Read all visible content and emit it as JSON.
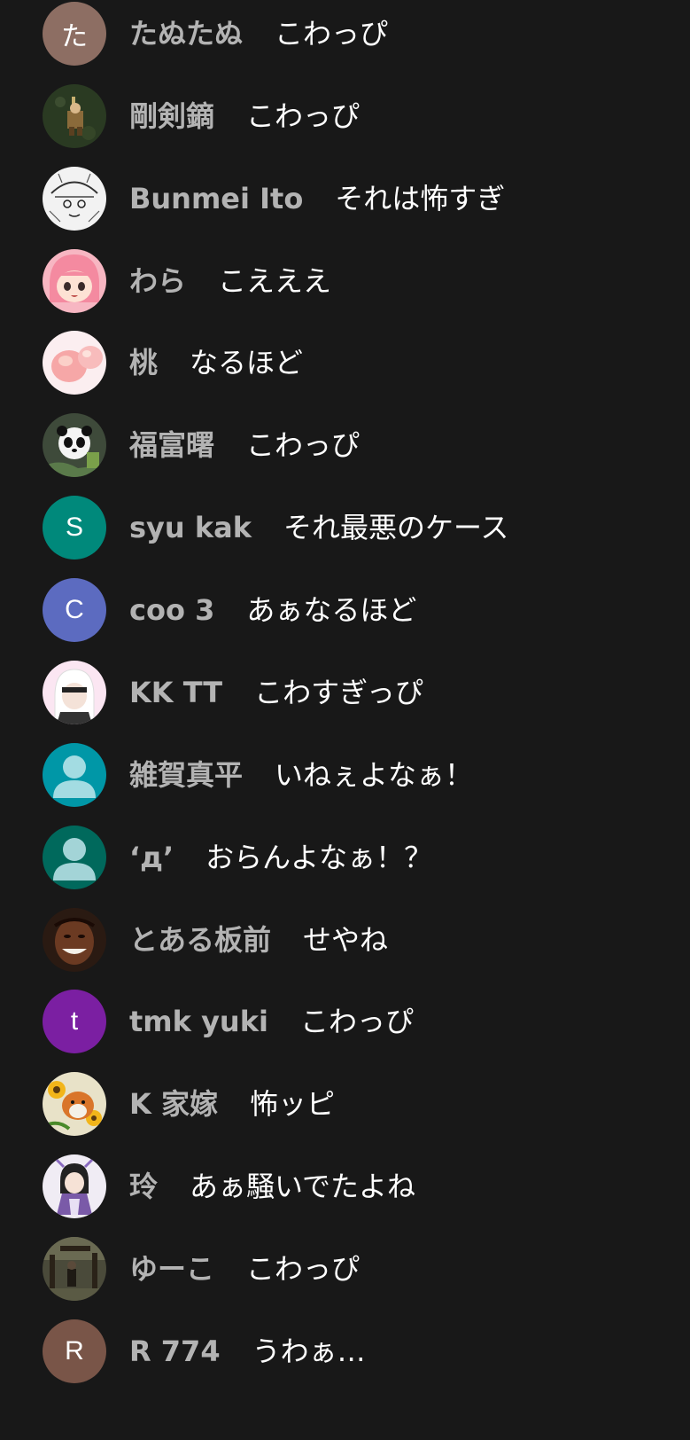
{
  "colors": {
    "background": "#181818",
    "author_text": "#b3b3b3",
    "message_text": "#ffffff"
  },
  "messages": [
    {
      "author": "たぬたぬ",
      "text": "こわっぴ",
      "avatar": {
        "type": "initial",
        "letter": "た",
        "color": "#8d6e63"
      }
    },
    {
      "author": "剛剣鏑",
      "text": "こわっぴ",
      "avatar": {
        "type": "image",
        "icon": "pixel-warrior-icon"
      }
    },
    {
      "author": "Bunmei Ito",
      "text": "それは怖すぎ",
      "avatar": {
        "type": "image",
        "icon": "manga-sketch-icon"
      }
    },
    {
      "author": "わら",
      "text": "こえええ",
      "avatar": {
        "type": "image",
        "icon": "pink-anime-girl-icon"
      }
    },
    {
      "author": "桃",
      "text": "なるほど",
      "avatar": {
        "type": "image",
        "icon": "peach-icon"
      }
    },
    {
      "author": "福富曙",
      "text": "こわっぴ",
      "avatar": {
        "type": "image",
        "icon": "panda-icon"
      }
    },
    {
      "author": "syu kak",
      "text": "それ最悪のケース",
      "avatar": {
        "type": "initial",
        "letter": "S",
        "color": "#00897b"
      }
    },
    {
      "author": "coo 3",
      "text": "あぁなるほど",
      "avatar": {
        "type": "initial",
        "letter": "C",
        "color": "#5c6bc0"
      }
    },
    {
      "author": "KK TT",
      "text": "こわすぎっぴ",
      "avatar": {
        "type": "image",
        "icon": "white-hair-anime-icon"
      }
    },
    {
      "author": "雑賀真平",
      "text": "いねぇよなぁ！",
      "avatar": {
        "type": "default",
        "icon": "default-person-icon",
        "color": "#0097a7"
      }
    },
    {
      "author": "‘д’",
      "text": "おらんよなぁ！？",
      "avatar": {
        "type": "default",
        "icon": "default-person-icon",
        "color": "#00695c"
      }
    },
    {
      "author": "とある板前",
      "text": "せやね",
      "avatar": {
        "type": "image",
        "icon": "smiling-man-icon"
      }
    },
    {
      "author": "tmk yuki",
      "text": "こわっぴ",
      "avatar": {
        "type": "initial",
        "letter": "t",
        "color": "#7b1fa2"
      }
    },
    {
      "author": "K 家嫁",
      "text": "怖ッピ",
      "avatar": {
        "type": "image",
        "icon": "sunflower-dog-icon"
      }
    },
    {
      "author": "玲",
      "text": "あぁ騒いでたよね",
      "avatar": {
        "type": "image",
        "icon": "anime-character-icon"
      }
    },
    {
      "author": "ゆーこ",
      "text": "こわっぴ",
      "avatar": {
        "type": "image",
        "icon": "garden-photo-icon"
      }
    },
    {
      "author": "R 774",
      "text": "うわぁ…",
      "avatar": {
        "type": "initial",
        "letter": "R",
        "color": "#795548"
      }
    }
  ]
}
